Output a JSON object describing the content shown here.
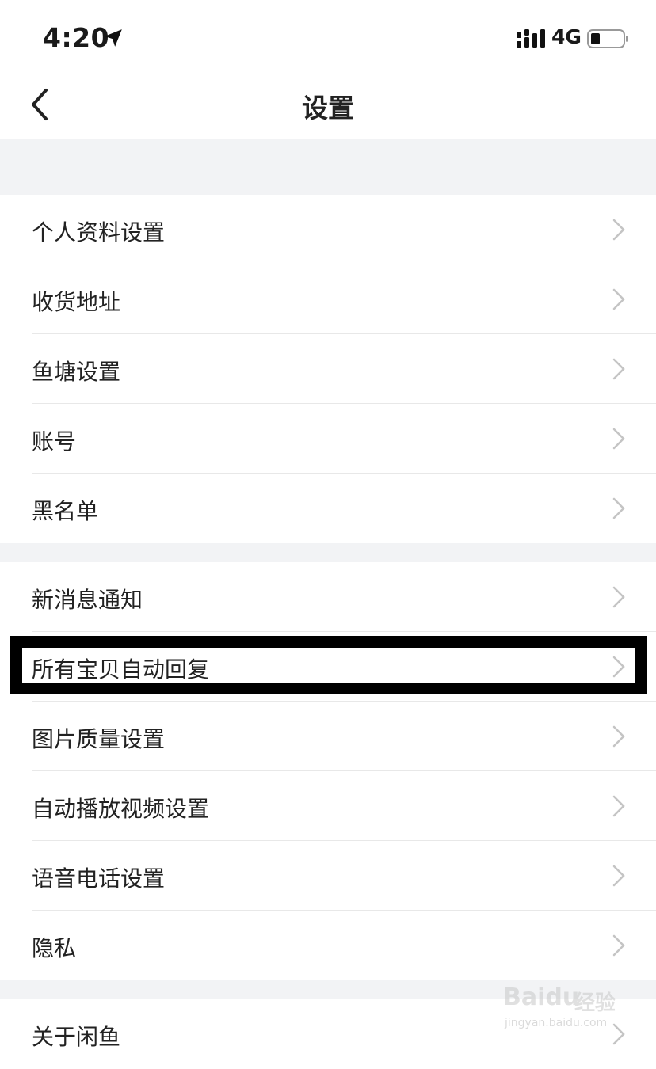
{
  "status_bar": {
    "time": "4:20",
    "network": "4G",
    "icons": [
      "location-arrow-icon",
      "signal-bars-icon",
      "battery-icon"
    ]
  },
  "nav": {
    "title": "设置",
    "back_icon": "chevron-left-icon"
  },
  "groups": [
    {
      "items": [
        {
          "label": "个人资料设置"
        },
        {
          "label": "收货地址"
        },
        {
          "label": "鱼塘设置"
        },
        {
          "label": "账号"
        },
        {
          "label": "黑名单"
        }
      ]
    },
    {
      "items": [
        {
          "label": "新消息通知"
        },
        {
          "label": "所有宝贝自动回复",
          "highlighted": true
        },
        {
          "label": "图片质量设置"
        },
        {
          "label": "自动播放视频设置"
        },
        {
          "label": "语音电话设置"
        },
        {
          "label": "隐私"
        }
      ]
    },
    {
      "items": [
        {
          "label": "关于闲鱼"
        }
      ]
    }
  ],
  "watermark": {
    "brand": "Baidu",
    "brand_cn": "经验",
    "url": "jingyan.baidu.com"
  },
  "colors": {
    "background": "#ffffff",
    "group_gap": "#f2f3f5",
    "divider": "#e8e8e8",
    "chevron": "#c4c4c4",
    "highlight_border": "#000000"
  }
}
